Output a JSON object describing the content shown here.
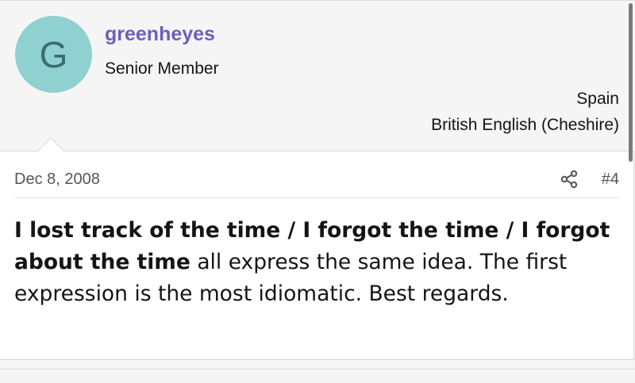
{
  "post": {
    "avatar_letter": "G",
    "username": "greenheyes",
    "user_title": "Senior Member",
    "location": "Spain",
    "language": "British English (Cheshire)",
    "date": "Dec 8, 2008",
    "post_number": "#4",
    "body_bold": "I lost track of the time / I forgot the time / I forgot about the time",
    "body_rest": " all express the same idea. The first expression is the most idiomatic. Best regards."
  },
  "colors": {
    "avatar_bg": "#8fd0d0",
    "username": "#6b5fc0"
  },
  "icons": {
    "share": "share-icon"
  }
}
